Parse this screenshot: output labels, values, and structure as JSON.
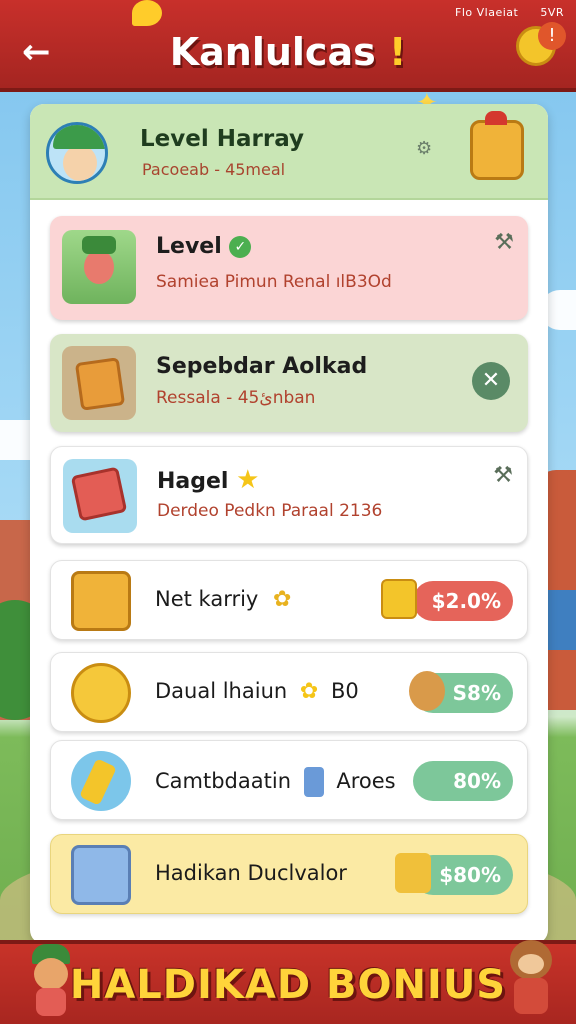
{
  "status_bar": {
    "left": "Flo Vlaeiat",
    "right": "5VR"
  },
  "header": {
    "title": "Kanlulcas",
    "title_bang": "!",
    "back_icon": "←",
    "notification": "!"
  },
  "profile": {
    "title": "Level Harray",
    "subtitle": "Pacoeab - 45meal"
  },
  "cards": [
    {
      "title": "Level",
      "subtitle": "Samiea Pimun Renal ılB3Od",
      "action_icon": "⚒"
    },
    {
      "title": "Sepebdar Aolkad",
      "subtitle": "Ressala - 4ئ5nban",
      "action_icon": "✕"
    },
    {
      "title": "Hagel",
      "subtitle": "Derdeo Pedkn Paraal 2136",
      "action_icon": "⚒"
    }
  ],
  "rows": [
    {
      "label": "Net karriy",
      "value": "$2.0%",
      "color": "#e5645a"
    },
    {
      "label": "Daual lhaiun",
      "extra": "B0",
      "value": "S8%",
      "color": "#7dc79a"
    },
    {
      "label": "Camtbdaatin",
      "extra": "Aroes",
      "value": "80%",
      "color": "#7dc79a"
    },
    {
      "label": "Hadikan Duclvalor",
      "value": "$80%",
      "color": "#7dc79a"
    }
  ],
  "banner": {
    "text": "HALDIKAD BONIUS"
  }
}
